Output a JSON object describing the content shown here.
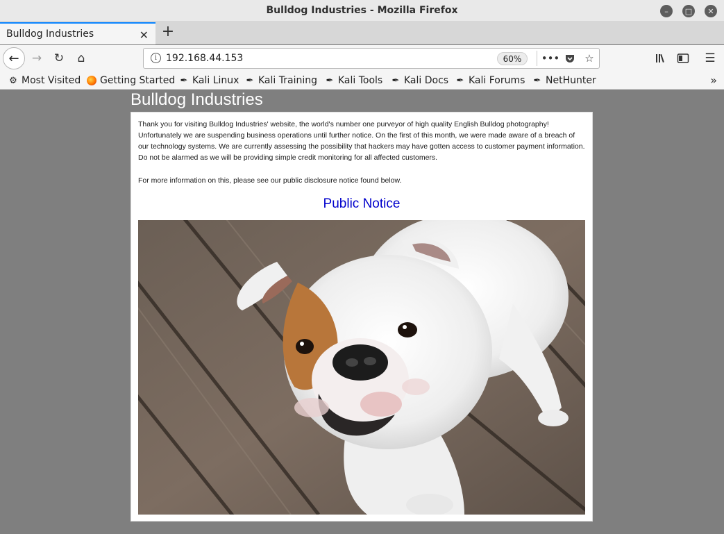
{
  "window": {
    "title": "Bulldog Industries - Mozilla Firefox"
  },
  "tabs": [
    {
      "label": "Bulldog Industries",
      "active": true
    }
  ],
  "navbar": {
    "url": "192.168.44.153",
    "zoom": "60%"
  },
  "bookmarks": [
    {
      "label": "Most Visited",
      "icon": "gear-icon"
    },
    {
      "label": "Getting Started",
      "icon": "firefox-icon"
    },
    {
      "label": "Kali Linux",
      "icon": "kali-dragon-icon"
    },
    {
      "label": "Kali Training",
      "icon": "kali-dragon-icon"
    },
    {
      "label": "Kali Tools",
      "icon": "kali-dragon-icon"
    },
    {
      "label": "Kali Docs",
      "icon": "kali-dragon-icon"
    },
    {
      "label": "Kali Forums",
      "icon": "kali-dragon-icon"
    },
    {
      "label": "NetHunter",
      "icon": "kali-dragon-icon"
    }
  ],
  "page": {
    "site_title": "Bulldog Industries",
    "paragraph1": "Thank you for visiting Bulldog Industries' website, the world's number one purveyor of high quality English Bulldog photography! Unfortunately we are suspending business operations until further notice. On the first of this month, we were made aware of a breach of our technology systems. We are currently assessing the possibility that hackers may have gotten access to customer payment information. Do not be alarmed as we will be providing simple credit monitoring for all affected customers.",
    "paragraph2": "For more information on this, please see our public disclosure notice found below.",
    "notice_link": "Public Notice"
  },
  "colors": {
    "page_bg": "#7f7f7f",
    "link": "#0000cc",
    "tab_accent": "#0a84ff"
  }
}
